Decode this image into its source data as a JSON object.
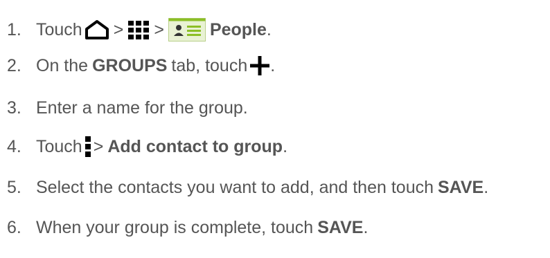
{
  "steps": [
    {
      "number": "1",
      "touch": "Touch",
      "sep1": ">",
      "sep2": ">",
      "app": "People",
      "end": ".",
      "icons": [
        "home-icon",
        "apps-grid-icon",
        "people-app-icon"
      ]
    },
    {
      "number": "2",
      "pre": "On the",
      "tab_name": "GROUPS",
      "post": "tab, touch",
      "end": ".",
      "icons": [
        "add-plus-icon"
      ]
    },
    {
      "number": "3",
      "text": "Enter a name for the group."
    },
    {
      "number": "4",
      "touch": "Touch",
      "sep": ">",
      "action": "Add contact to group",
      "end": ".",
      "icons": [
        "menu-more-icon"
      ]
    },
    {
      "number": "5",
      "pre": "Select the contacts you want to add, and then touch",
      "action": "SAVE",
      "end": "."
    },
    {
      "number": "6",
      "pre": "When your group is complete, touch",
      "action": "SAVE",
      "end": "."
    }
  ],
  "colors": {
    "text": "#555555",
    "icon_dark": "#000000",
    "people_icon_green": "#8cbf26"
  }
}
